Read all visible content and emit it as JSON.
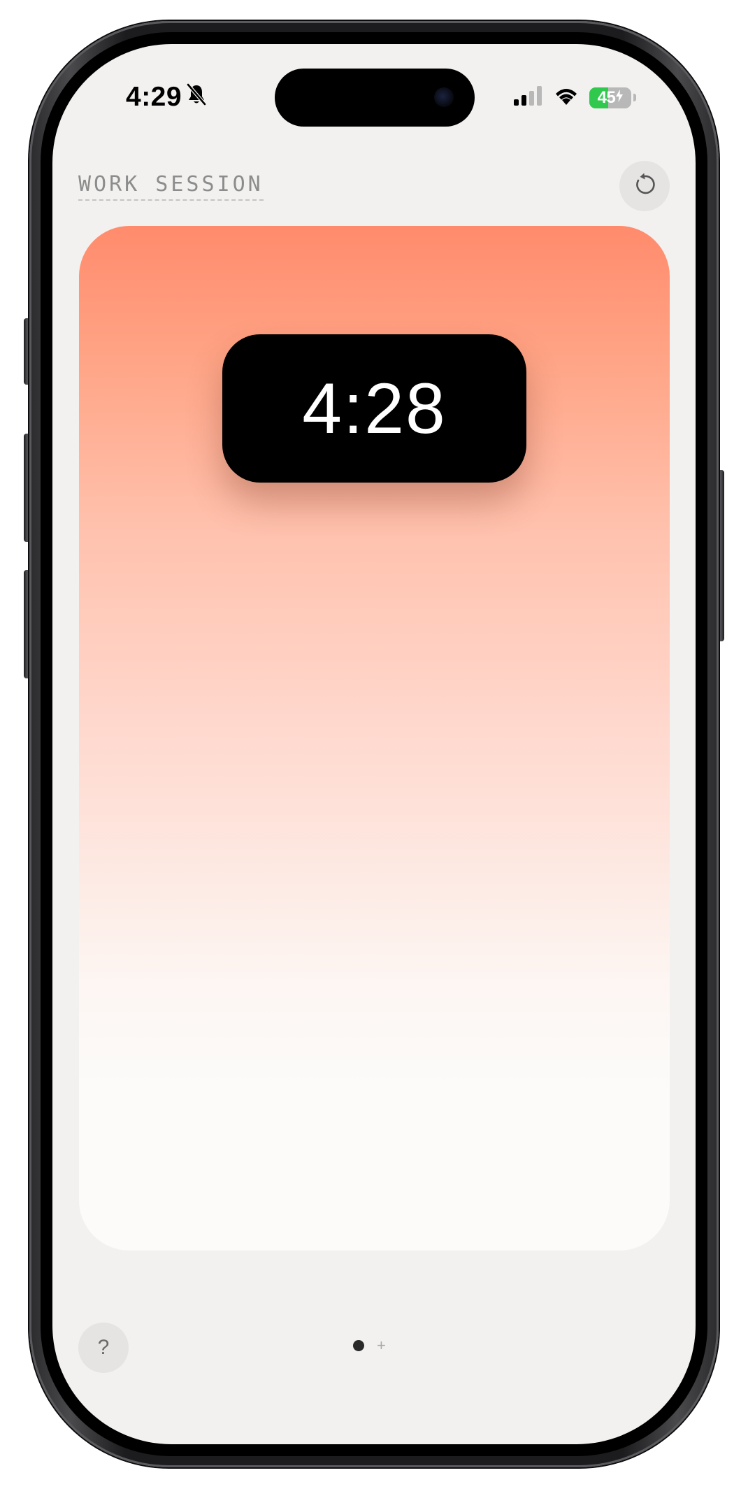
{
  "status_bar": {
    "time": "4:29",
    "silent_icon": "bell-slash-icon",
    "signal_icon": "cellular-signal-icon",
    "wifi_icon": "wifi-icon",
    "battery_percent": "45",
    "battery_level": 0.45,
    "battery_charging_icon": "bolt-icon",
    "battery_color": "#30c94d"
  },
  "header": {
    "title": "WORK SESSION",
    "reset_icon": "reset-arrow-icon"
  },
  "timer": {
    "display": "4:28",
    "gradient_top": "#ff8b6c",
    "gradient_bottom": "#fcfbf9"
  },
  "footer": {
    "help_label": "?",
    "page_add_label": "+"
  }
}
